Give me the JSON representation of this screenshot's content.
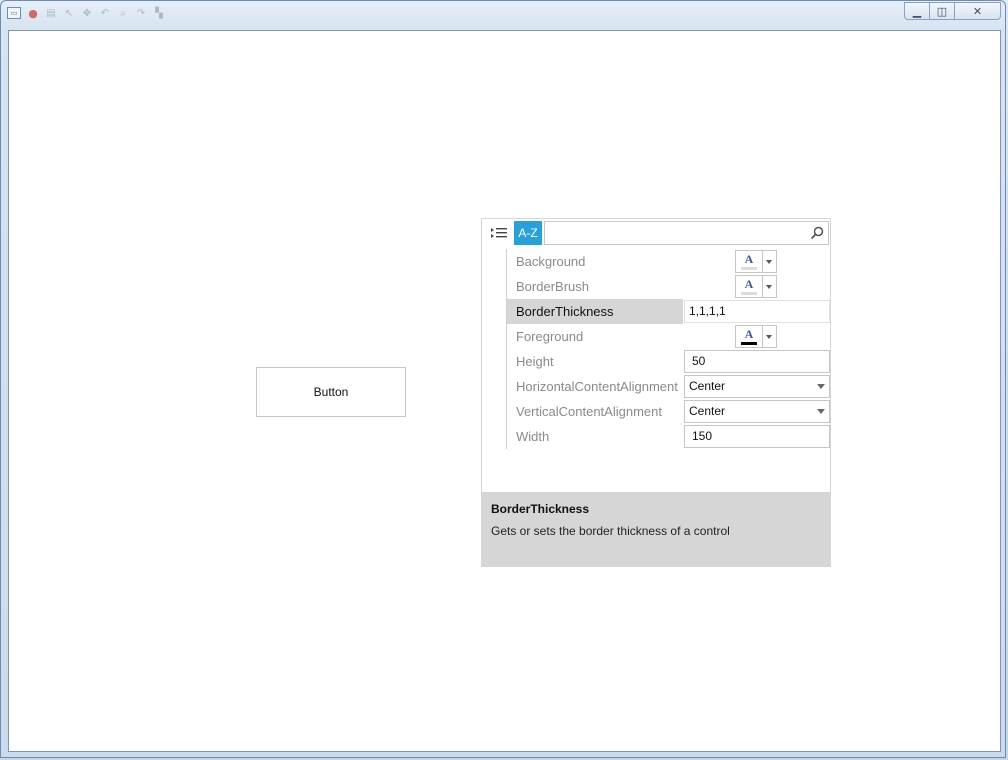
{
  "window": {
    "caption_buttons": {
      "minimize_icon": "minimize-icon",
      "maximize_icon": "restore-icon",
      "close_icon": "close-icon"
    }
  },
  "sample": {
    "button_label": "Button"
  },
  "property_grid": {
    "toolbar": {
      "categorized_icon": "categorized-list-icon",
      "alphabetical_label": "A-Z",
      "search_value": "",
      "search_icon": "search-icon"
    },
    "properties": [
      {
        "name": "Background",
        "editor": "brush",
        "value": ""
      },
      {
        "name": "BorderBrush",
        "editor": "brush",
        "value": ""
      },
      {
        "name": "BorderThickness",
        "editor": "text",
        "value": "1,1,1,1",
        "selected": true
      },
      {
        "name": "Foreground",
        "editor": "brush",
        "value": ""
      },
      {
        "name": "Height",
        "editor": "text",
        "value": "50"
      },
      {
        "name": "HorizontalContentAlignment",
        "editor": "combo",
        "value": "Center"
      },
      {
        "name": "VerticalContentAlignment",
        "editor": "combo",
        "value": "Center"
      },
      {
        "name": "Width",
        "editor": "text",
        "value": "150"
      }
    ],
    "description": {
      "title": "BorderThickness",
      "text": "Gets or sets the border thickness of a control"
    },
    "colors": {
      "accent": "#2aa0d8",
      "selected_row": "#d6d6d6",
      "description_bg": "#d6d6d6"
    }
  }
}
